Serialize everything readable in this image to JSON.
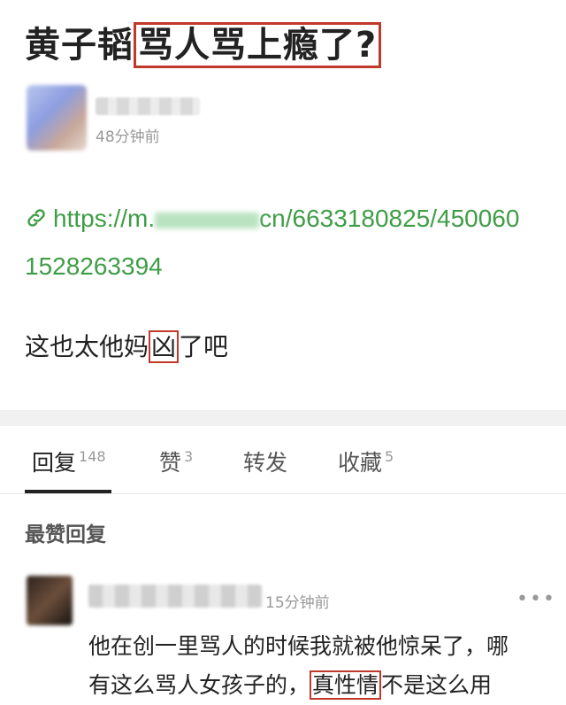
{
  "post": {
    "title_prefix": "黄子韬",
    "title_highlight": "骂人骂上瘾了?",
    "time": "48分钟前",
    "link_part1": "https://m.",
    "link_part2": "cn/6633180825/450060 1528263394",
    "text_before": "这也太他妈",
    "text_highlight": "凶",
    "text_after": "了吧"
  },
  "tabs": [
    {
      "label": "回复",
      "count": "148"
    },
    {
      "label": "赞",
      "count": "3"
    },
    {
      "label": "转发",
      "count": ""
    },
    {
      "label": "收藏",
      "count": "5"
    }
  ],
  "section_title": "最赞回复",
  "comment": {
    "time": "15分钟前",
    "more": "•••",
    "line1": "他在创一里骂人的时候我就被他惊呆了，哪",
    "line2_a": "有这么骂人女孩子的，",
    "line2_hl": "真性情",
    "line2_b": "不是这么用"
  }
}
